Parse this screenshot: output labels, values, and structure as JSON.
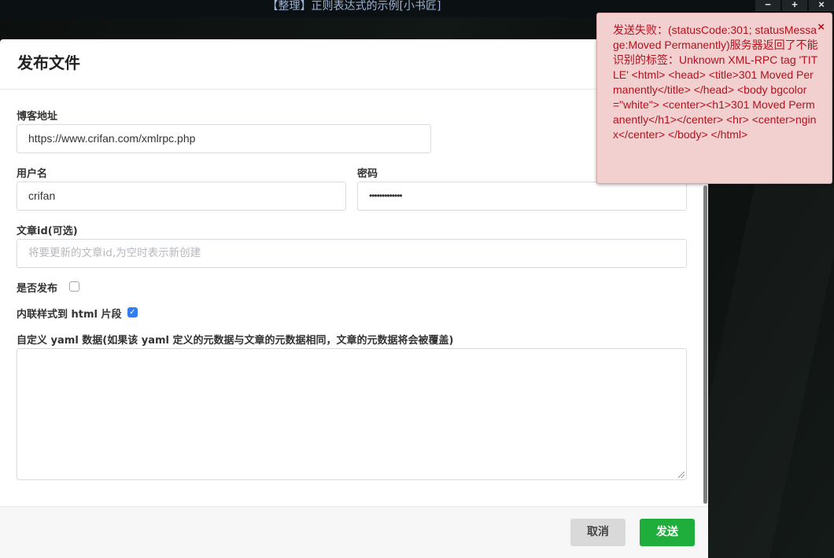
{
  "window": {
    "title": "【整理】正则表达式的示例[小书匠]",
    "buttons": [
      "−",
      "+",
      "×"
    ]
  },
  "dialog": {
    "title": "发布文件",
    "blog_url_label": "博客地址",
    "blog_url_value": "https://www.crifan.com/xmlrpc.php",
    "username_label": "用户名",
    "username_value": "crifan",
    "password_label": "密码",
    "password_value": "•••••••••••••",
    "article_id_label": "文章id(可选)",
    "article_id_placeholder": "将要更新的文章id,为空时表示新创建",
    "publish_label": "是否发布",
    "publish_checked": false,
    "inline_style_label": "内联样式到 html 片段",
    "inline_style_checked": true,
    "yaml_label": "自定义 yaml 数据(如果该 yaml 定义的元数据与文章的元数据相同，文章的元数据将会被覆盖)",
    "yaml_value": "",
    "cancel_label": "取消",
    "send_label": "发送"
  },
  "toast": {
    "message": "发送失败：(statusCode:301; statusMessage:Moved Permanently)服务器返回了不能识别的标签：Unknown XML-RPC tag 'TITLE' <html> <head> <title>301 Moved Permanently</title> </head> <body bgcolor=\"white\"> <center><h1>301 Moved Permanently</h1></center> <hr> <center>nginx</center> </body> </html>",
    "close_icon": "×"
  },
  "colors": {
    "send_button": "#1fae3c",
    "toast_bg": "#f2d0d0",
    "toast_text": "#b0121d",
    "checkbox_checked": "#2e7cf6"
  }
}
